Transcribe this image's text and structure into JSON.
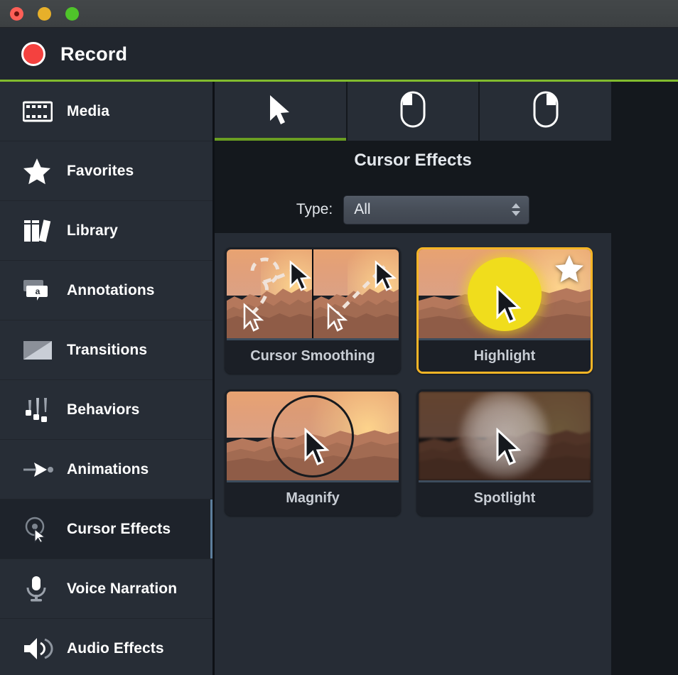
{
  "window": {
    "traffic_lights": [
      {
        "name": "close",
        "color": "#ff5f57"
      },
      {
        "name": "minimize",
        "color": "#e7b02a"
      },
      {
        "name": "maximize",
        "color": "#4fc42a"
      }
    ]
  },
  "header": {
    "record_label": "Record",
    "record_dot_color": "#f4413f",
    "accent_rule_color": "#82bc2e"
  },
  "sidebar": {
    "selected": "Cursor Effects",
    "selection_indicator_color": "#5d7e9c",
    "items": [
      {
        "label": "Media",
        "icon": "film-strip-icon"
      },
      {
        "label": "Favorites",
        "icon": "star-icon"
      },
      {
        "label": "Library",
        "icon": "books-icon"
      },
      {
        "label": "Annotations",
        "icon": "speech-bubble-a-icon"
      },
      {
        "label": "Transitions",
        "icon": "transition-split-icon"
      },
      {
        "label": "Behaviors",
        "icon": "behaviors-pins-icon"
      },
      {
        "label": "Animations",
        "icon": "arrow-keyframe-icon"
      },
      {
        "label": "Cursor Effects",
        "icon": "cursor-target-icon"
      },
      {
        "label": "Voice Narration",
        "icon": "microphone-icon"
      },
      {
        "label": "Audio Effects",
        "icon": "speaker-waves-icon"
      }
    ]
  },
  "main": {
    "tabs": [
      {
        "name": "cursor",
        "icon": "cursor-arrow-icon",
        "active": true
      },
      {
        "name": "left-click",
        "icon": "mouse-left-button-icon",
        "active": false
      },
      {
        "name": "right-click",
        "icon": "mouse-right-button-icon",
        "active": false
      }
    ],
    "active_tab_underline_color": "#6a9e22",
    "panel_title": "Cursor Effects",
    "filter": {
      "label": "Type:",
      "selected_value": "All",
      "options": [
        "All"
      ]
    },
    "selected_effect": "Highlight",
    "selection_border_color": "#f5b526",
    "effects": [
      {
        "label": "Cursor Smoothing",
        "thumb": "split-dashed-cursor-paths",
        "selected": false,
        "favorite": false
      },
      {
        "label": "Highlight",
        "thumb": "yellow-circle-behind-cursor",
        "selected": true,
        "favorite": true,
        "highlight_color": "#f0dd1c"
      },
      {
        "label": "Magnify",
        "thumb": "magnifier-ring-around-cursor",
        "selected": false,
        "favorite": false
      },
      {
        "label": "Spotlight",
        "thumb": "dimmed-scene-with-bright-spot",
        "selected": false,
        "favorite": false
      }
    ]
  }
}
